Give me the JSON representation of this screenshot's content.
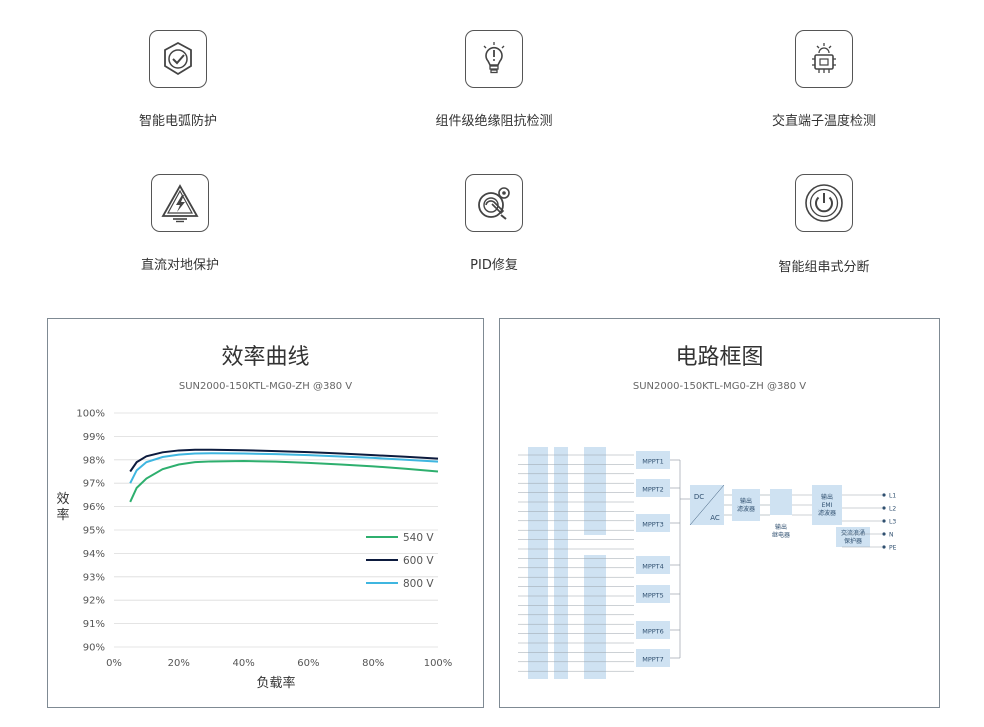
{
  "features": [
    {
      "icon": "shield-check-icon",
      "label": "智能电弧防护"
    },
    {
      "icon": "lightbulb-alert-icon",
      "label": "组件级绝缘阻抗检测"
    },
    {
      "icon": "chip-temperature-icon",
      "label": "交直端子温度检测"
    },
    {
      "icon": "high-voltage-warning-icon",
      "label": "直流对地保护"
    },
    {
      "icon": "repair-gear-icon",
      "label": "PID修复"
    },
    {
      "icon": "power-button-icon",
      "label": "智能组串式分断"
    }
  ],
  "efficiency_panel": {
    "title": "效率曲线",
    "subtitle": "SUN2000-150KTL-MG0-ZH @380 V"
  },
  "circuit_panel": {
    "title": "电路框图",
    "subtitle": "SUN2000-150KTL-MG0-ZH @380 V",
    "mppt_labels": [
      "MPPT1",
      "MPPT2",
      "MPPT3",
      "MPPT4",
      "MPPT5",
      "MPPT6",
      "MPPT7"
    ],
    "dc_label": "DC",
    "ac_label": "AC",
    "output_filter": "输出\n滤波器",
    "output_relay": "输出\n继电器",
    "output_emi_filter": "输出\nEMI\n滤波器",
    "surge_protector": "交流浪涌\n保护器",
    "outputs": [
      "L1",
      "L2",
      "L3",
      "N",
      "PE"
    ]
  },
  "chart_data": {
    "type": "line",
    "title": "效率曲线",
    "subtitle": "SUN2000-150KTL-MG0-ZH @380 V",
    "xlabel": "负载率",
    "ylabel": "效率",
    "xlim": [
      0,
      100
    ],
    "ylim": [
      90,
      100
    ],
    "x_ticks": [
      "0%",
      "20%",
      "40%",
      "60%",
      "80%",
      "100%"
    ],
    "y_ticks": [
      "90%",
      "91%",
      "92%",
      "93%",
      "94%",
      "95%",
      "96%",
      "97%",
      "98%",
      "99%",
      "100%"
    ],
    "grid": true,
    "legend_position": "right-middle",
    "series": [
      {
        "name": "540 V",
        "color": "#2eaf6e",
        "x": [
          5,
          7,
          10,
          15,
          20,
          25,
          30,
          40,
          50,
          60,
          70,
          80,
          90,
          100
        ],
        "y": [
          96.2,
          96.8,
          97.2,
          97.6,
          97.8,
          97.9,
          97.93,
          97.95,
          97.92,
          97.87,
          97.8,
          97.72,
          97.62,
          97.5
        ]
      },
      {
        "name": "600 V",
        "color": "#0d1b3e",
        "x": [
          5,
          7,
          10,
          15,
          20,
          25,
          30,
          40,
          50,
          60,
          70,
          80,
          90,
          100
        ],
        "y": [
          97.5,
          97.9,
          98.15,
          98.32,
          98.4,
          98.43,
          98.43,
          98.41,
          98.37,
          98.33,
          98.27,
          98.2,
          98.13,
          98.05
        ]
      },
      {
        "name": "800 V",
        "color": "#3fb6e0",
        "x": [
          5,
          7,
          10,
          15,
          20,
          25,
          30,
          40,
          50,
          60,
          70,
          80,
          90,
          100
        ],
        "y": [
          97.0,
          97.55,
          97.9,
          98.12,
          98.22,
          98.27,
          98.28,
          98.27,
          98.24,
          98.2,
          98.14,
          98.08,
          98.0,
          97.92
        ]
      }
    ]
  }
}
